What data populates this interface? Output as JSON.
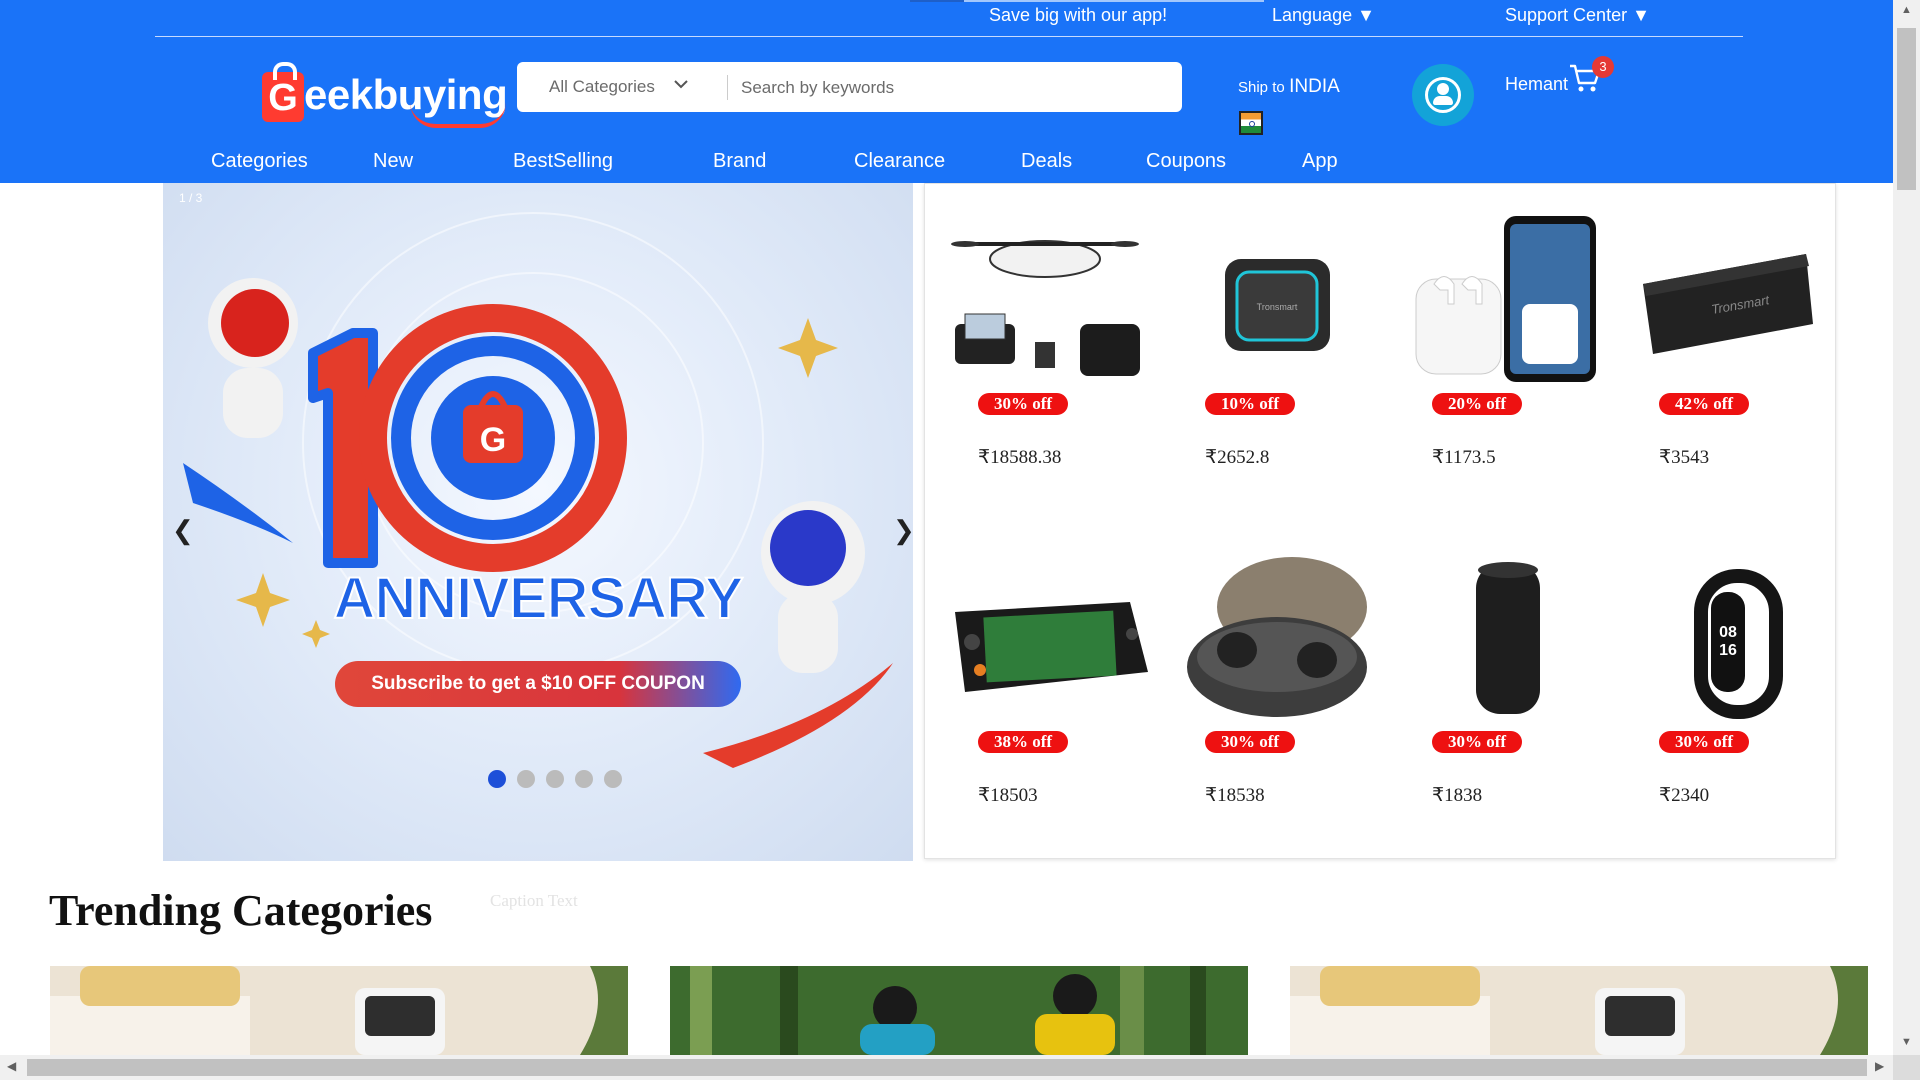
{
  "topbar": {
    "app_promo": "Save big with our app!",
    "language": "Language ▼",
    "support": "Support Center ▼"
  },
  "logo": {
    "letter": "G",
    "text": "eekbuying"
  },
  "search": {
    "category": "All Categories",
    "placeholder": "Search by keywords"
  },
  "ship": {
    "label": "Ship to",
    "country": "INDIA"
  },
  "user": {
    "name": "Hemant",
    "cart_count": "3"
  },
  "nav": {
    "items": [
      "Categories",
      "New",
      "BestSelling",
      "Brand",
      "Clearance",
      "Deals",
      "Coupons",
      "App"
    ]
  },
  "carousel": {
    "slide_counter": "1 / 3",
    "prev": "❮",
    "next": "❯",
    "headline": "ANNIVERSARY",
    "subscribe": "Subscribe to get a $10 OFF COUPON",
    "dots": 5,
    "active_dot": 1,
    "caption": "Caption Text"
  },
  "products": [
    {
      "name": "drone",
      "discount": "30% off",
      "price": "₹18588.38"
    },
    {
      "name": "cube-speaker",
      "discount": "10% off",
      "price": "₹2652.8"
    },
    {
      "name": "earbuds-phone",
      "discount": "20% off",
      "price": "₹1173.5"
    },
    {
      "name": "bar-speaker",
      "discount": "42% off",
      "price": "₹3543"
    },
    {
      "name": "handheld-console",
      "discount": "38% off",
      "price": "₹18503"
    },
    {
      "name": "earbuds-case",
      "discount": "30% off",
      "price": "₹18538"
    },
    {
      "name": "tower-speaker",
      "discount": "30% off",
      "price": "₹1838"
    },
    {
      "name": "smart-band",
      "discount": "30% off",
      "price": "₹2340"
    }
  ],
  "trending": {
    "title": "Trending Categories"
  },
  "colors": {
    "header_bg": "#1a73f8",
    "discount_bg": "#ee1111",
    "active_dot": "#1d4fd8"
  }
}
